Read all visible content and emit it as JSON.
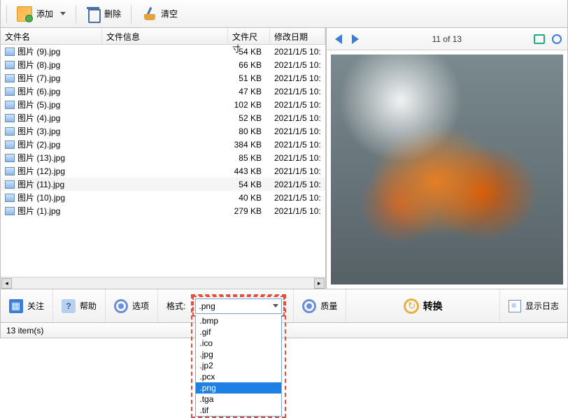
{
  "toolbar": {
    "add": "添加",
    "delete": "删除",
    "clear": "清空"
  },
  "columns": {
    "name": "文件名",
    "info": "文件信息",
    "size": "文件尺寸",
    "date": "修改日期"
  },
  "files": [
    {
      "name": "图片 (9).jpg",
      "size": "54 KB",
      "date": "2021/1/5 10:"
    },
    {
      "name": "图片 (8).jpg",
      "size": "66 KB",
      "date": "2021/1/5 10:"
    },
    {
      "name": "图片 (7).jpg",
      "size": "51 KB",
      "date": "2021/1/5 10:"
    },
    {
      "name": "图片 (6).jpg",
      "size": "47 KB",
      "date": "2021/1/5 10:"
    },
    {
      "name": "图片 (5).jpg",
      "size": "102 KB",
      "date": "2021/1/5 10:"
    },
    {
      "name": "图片 (4).jpg",
      "size": "52 KB",
      "date": "2021/1/5 10:"
    },
    {
      "name": "图片 (3).jpg",
      "size": "80 KB",
      "date": "2021/1/5 10:"
    },
    {
      "name": "图片 (2).jpg",
      "size": "384 KB",
      "date": "2021/1/5 10:"
    },
    {
      "name": "图片 (13).jpg",
      "size": "85 KB",
      "date": "2021/1/5 10:"
    },
    {
      "name": "图片 (12).jpg",
      "size": "443 KB",
      "date": "2021/1/5 10:"
    },
    {
      "name": "图片 (11).jpg",
      "size": "54 KB",
      "date": "2021/1/5 10:"
    },
    {
      "name": "图片 (10).jpg",
      "size": "40 KB",
      "date": "2021/1/5 10:"
    },
    {
      "name": "图片 (1).jpg",
      "size": "279 KB",
      "date": "2021/1/5 10:"
    }
  ],
  "selected_row_index": 10,
  "preview": {
    "counter": "11 of 13"
  },
  "bottom": {
    "follow": "关注",
    "help": "帮助",
    "options": "选项",
    "format_label": "格式:",
    "quality": "质量",
    "convert": "转换",
    "show_log": "显示日志"
  },
  "format": {
    "selected": ".png",
    "options": [
      ".bmp",
      ".gif",
      ".ico",
      ".jpg",
      ".jp2",
      ".pcx",
      ".png",
      ".tga",
      ".tif"
    ]
  },
  "status": {
    "text": "13 item(s)"
  }
}
